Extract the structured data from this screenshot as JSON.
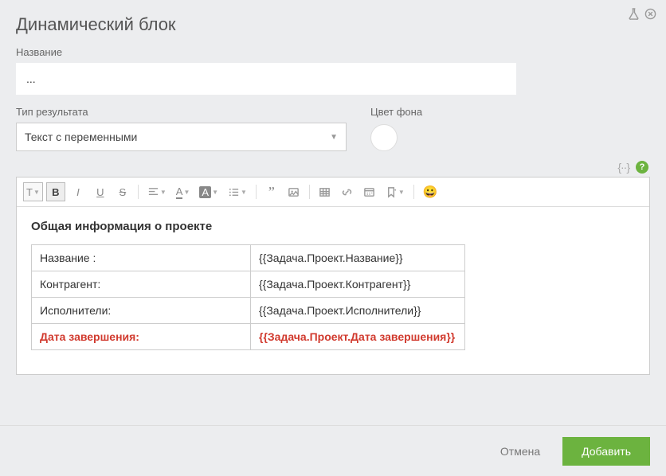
{
  "dialog": {
    "title": "Динамический блок"
  },
  "fields": {
    "name_label": "Название",
    "name_value": "...",
    "result_type_label": "Тип результата",
    "result_type_value": "Текст с переменными",
    "bg_color_label": "Цвет фона"
  },
  "content": {
    "heading": "Общая информация о проекте",
    "rows": [
      {
        "label": "Название :",
        "value": "{{Задача.Проект.Название}}"
      },
      {
        "label": "Контрагент:",
        "value": "{{Задача.Проект.Контрагент}}"
      },
      {
        "label": "Исполнители:",
        "value": "{{Задача.Проект.Исполнители}}"
      },
      {
        "label": "Дата завершения:",
        "value": "{{Задача.Проект.Дата завершения}}"
      }
    ]
  },
  "footer": {
    "cancel": "Отмена",
    "add": "Добавить"
  },
  "toolbar_labels": {
    "text": "T",
    "bold": "B",
    "italic": "I",
    "underline": "U",
    "strike": "S",
    "fontcolor": "A",
    "bgcolor": "A",
    "quote": "”",
    "emoji": "😀"
  }
}
